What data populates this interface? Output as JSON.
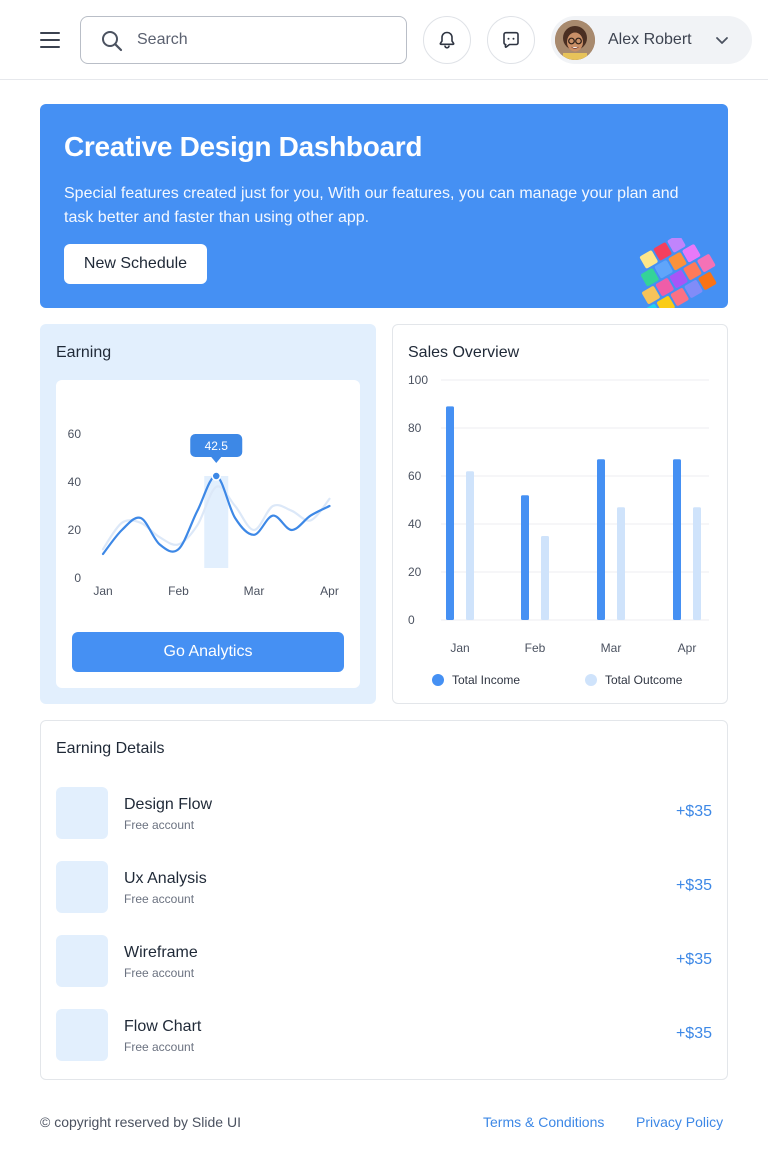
{
  "header": {
    "search_placeholder": "Search",
    "user_name": "Alex Robert",
    "icons": [
      "menu-icon",
      "search-icon",
      "bell-icon",
      "chat-icon",
      "chevron-down-icon"
    ]
  },
  "hero": {
    "title": "Creative Design Dashboard",
    "description": "Special features created just for you, With our features, you can manage your plan and task better and faster than using other app.",
    "button_label": "New Schedule",
    "background": "#4590f3"
  },
  "earning": {
    "title": "Earning",
    "button_label": "Go Analytics"
  },
  "sales": {
    "title": "Sales Overview"
  },
  "colors": {
    "accent": "#4590f3",
    "accent_light": "#cfe3fb",
    "card_light": "#e2effd",
    "amount": "#3d88e6"
  },
  "chart_data": [
    {
      "type": "line",
      "title": "Earning",
      "categories": [
        "Jan",
        "Feb",
        "Mar",
        "Apr"
      ],
      "y_ticks": [
        0,
        20,
        40,
        60
      ],
      "ylim": [
        0,
        60
      ],
      "series": [
        {
          "x": [
            0,
            0.25,
            0.5,
            0.75,
            1,
            1.25,
            1.5,
            1.75,
            2,
            2.25,
            2.5,
            2.75,
            3
          ],
          "values": [
            10,
            20,
            25,
            14,
            12,
            28,
            42.5,
            25,
            18,
            26,
            20,
            26,
            30
          ]
        },
        {
          "x": [
            0,
            0.25,
            0.5,
            0.75,
            1,
            1.25,
            1.5,
            1.75,
            2,
            2.25,
            2.5,
            2.75,
            3
          ],
          "values": [
            12,
            23,
            23,
            17,
            14,
            22,
            38,
            30,
            20,
            30,
            28,
            24,
            33
          ]
        }
      ],
      "highlight": {
        "category": "Mar",
        "value": 42.5,
        "label": "42.5"
      },
      "grid": false
    },
    {
      "type": "bar",
      "title": "Sales Overview",
      "categories": [
        "Jan",
        "Feb",
        "Mar",
        "Apr"
      ],
      "y_ticks": [
        0,
        20,
        40,
        60,
        80,
        100
      ],
      "ylim": [
        0,
        100
      ],
      "series": [
        {
          "name": "Total Income",
          "values": [
            89,
            52,
            67,
            67
          ],
          "color": "#4590f3"
        },
        {
          "name": "Total Outcome",
          "values": [
            62,
            35,
            47,
            47
          ],
          "color": "#cfe3fb"
        }
      ],
      "grid": true,
      "legend": "bottom"
    }
  ],
  "details": {
    "title": "Earning Details",
    "items": [
      {
        "name": "Design Flow",
        "sub": "Free account",
        "amount": "+$35"
      },
      {
        "name": "Ux Analysis",
        "sub": "Free account",
        "amount": "+$35"
      },
      {
        "name": "Wireframe",
        "sub": "Free account",
        "amount": "+$35"
      },
      {
        "name": "Flow Chart",
        "sub": "Free account",
        "amount": "+$35"
      }
    ]
  },
  "footer": {
    "copyright": "© copyright reserved by Slide UI",
    "terms": "Terms & Conditions",
    "privacy": "Privacy Policy"
  }
}
